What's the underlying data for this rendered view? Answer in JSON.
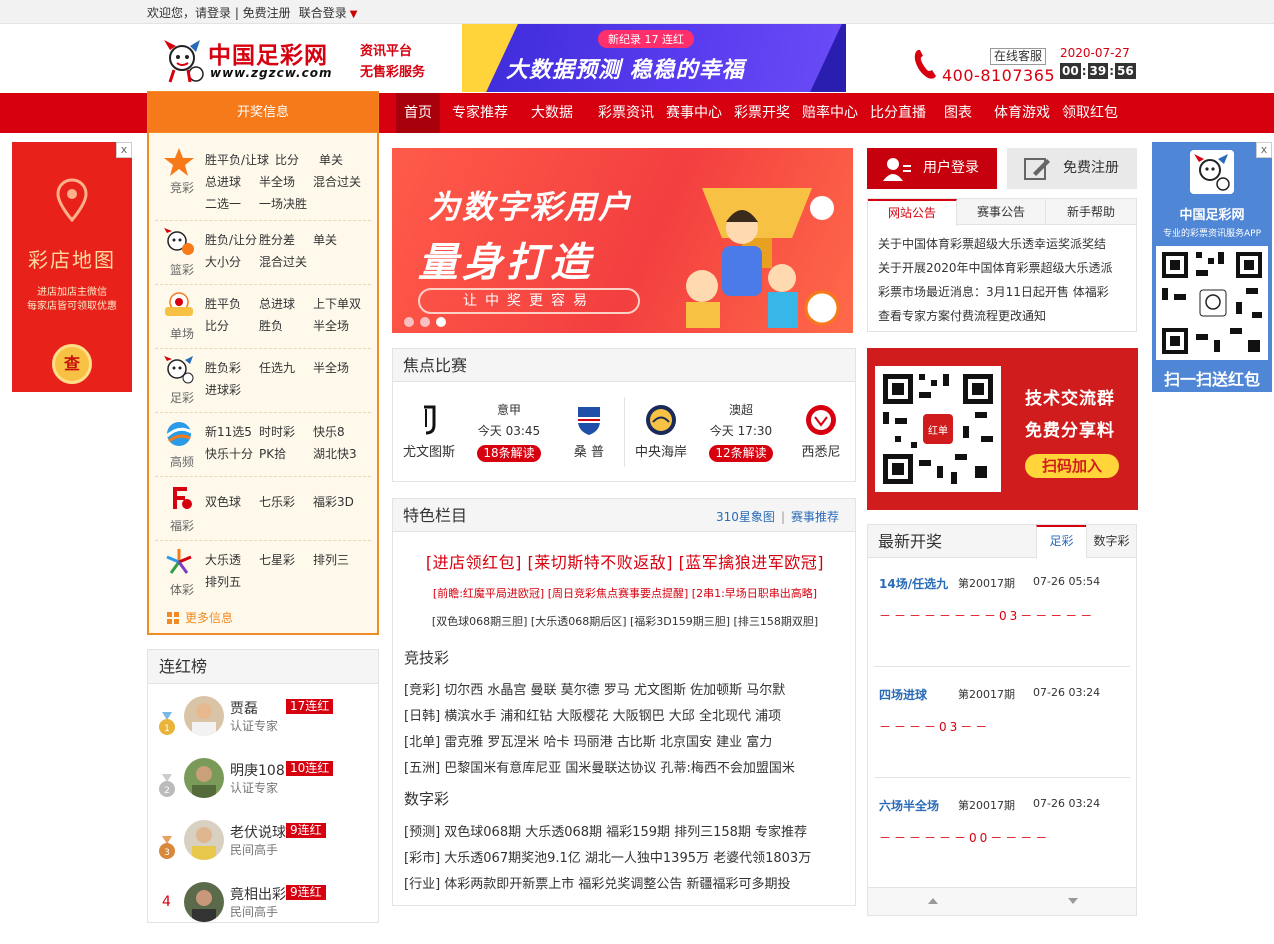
{
  "topbar": {
    "welcome": "欢迎您，请登录 | 免费注册",
    "union_login": "联合登录"
  },
  "header": {
    "logo_name": "中国足彩网",
    "logo_url": "www.zgzcw.com",
    "slogan1": "资讯平台",
    "slogan2": "无售彩服务",
    "banner_pill": "新纪录 17 连红",
    "banner_text": "大数据预测 稳稳的幸福",
    "online_service": "在线客服",
    "hotline": "400-8107365",
    "date": "2020-07-27",
    "clock": {
      "h": "00",
      "m": "39",
      "s": "56"
    }
  },
  "nav": {
    "kaijiang": "开奖信息",
    "items": [
      "首页",
      "专家推荐",
      "大数据",
      "彩票资讯",
      "赛事中心",
      "彩票开奖",
      "赔率中心",
      "比分直播",
      "图表",
      "体育游戏",
      "领取红包"
    ]
  },
  "side_ad": {
    "close": "x",
    "title": "彩店地图",
    "line1": "进店加店主微信",
    "line2": "每家店皆可领取优惠",
    "button": "查"
  },
  "lottery": {
    "rows": [
      {
        "cap": "竞彩",
        "links": [
          "胜平负/让球",
          "比分",
          "单关",
          "总进球",
          "半全场",
          "混合过关",
          "二选一",
          "一场决胜"
        ]
      },
      {
        "cap": "篮彩",
        "links": [
          "胜负/让分",
          "胜分差",
          "单关",
          "大小分",
          "混合过关"
        ]
      },
      {
        "cap": "单场",
        "links": [
          "胜平负",
          "总进球",
          "上下单双",
          "比分",
          "胜负",
          "半全场"
        ]
      },
      {
        "cap": "足彩",
        "links": [
          "胜负彩",
          "任选九",
          "半全场",
          "进球彩"
        ]
      },
      {
        "cap": "高频",
        "links": [
          "新11选5",
          "时时彩",
          "快乐8",
          "快乐十分",
          "PK拾",
          "湖北快3"
        ]
      },
      {
        "cap": "福彩",
        "links": [
          "双色球",
          "七乐彩",
          "福彩3D"
        ]
      },
      {
        "cap": "体彩",
        "links": [
          "大乐透",
          "七星彩",
          "排列三",
          "排列五"
        ]
      }
    ],
    "more": "更多信息"
  },
  "lhb": {
    "title": "连红榜",
    "users": [
      {
        "name": "贾磊",
        "level": "认证专家",
        "streak": "17连红",
        "rank": "1"
      },
      {
        "name": "明庚108",
        "level": "认证专家",
        "streak": "10连红",
        "rank": "2"
      },
      {
        "name": "老伏说球",
        "level": "民间高手",
        "streak": "9连红",
        "rank": "3"
      },
      {
        "name": "竟相出彩",
        "level": "民间高手",
        "streak": "9连红",
        "rank": "4"
      }
    ]
  },
  "banner": {
    "h1": "为数字彩用户",
    "h2": "量身打造",
    "sub": "让中奖更容易"
  },
  "focus": {
    "title": "焦点比赛",
    "matches": [
      {
        "league": "意甲",
        "time": "今天 03:45",
        "home": "尤文图斯",
        "away": "桑 普",
        "jiedu": "18条解读"
      },
      {
        "league": "澳超",
        "time": "今天 17:30",
        "home": "中央海岸",
        "away": "西悉尼",
        "jiedu": "12条解读"
      }
    ]
  },
  "featured": {
    "title": "特色栏目",
    "link1": "310星象图",
    "link2": "赛事推荐",
    "headline": "[进店领红包] [莱切斯特不败返敌] [蓝军擒狼进军欧冠]",
    "sub1": "[前瞻:红魔平局进欧冠] [周日竞彩焦点赛事要点提醒] [2串1:早场日职串出高略]",
    "sub2": "[双色球068期三胆] [大乐透068期后区] [福彩3D159期三胆] [排三158期双胆]",
    "sec1": "竞技彩",
    "lines1": [
      "[竞彩] 切尔西 水晶宫 曼联 莫尔德 罗马 尤文图斯 佐加顿斯 马尔默",
      "[日韩] 横滨水手 浦和红钻 大阪樱花 大阪钢巴 大邱 全北现代 浦项",
      "[北单] 雷克雅 罗瓦涅米 哈卡 玛丽港 古比斯 北京国安 建业 富力",
      "[五洲] 巴黎国米有意库尼亚 国米曼联达协议 孔蒂:梅西不会加盟国米"
    ],
    "sec2": "数字彩",
    "lines2": [
      "[预测] 双色球068期 大乐透068期 福彩159期 排列三158期 专家推荐",
      "[彩市] 大乐透067期奖池9.1亿 湖北一人独中1395万 老婆代领1803万",
      "[行业] 体彩两款即开新票上市 福彩兑奖调整公告 新疆福彩可多期投"
    ]
  },
  "login": {
    "login": "用户登录",
    "register": "免费注册"
  },
  "notice": {
    "tabs": [
      "网站公告",
      "赛事公告",
      "新手帮助"
    ],
    "items": [
      "关于中国体育彩票超级大乐透幸运奖派奖结",
      "关于开展2020年中国体育彩票超级大乐透派",
      "彩票市场最近消息：3月11日起开售 体福彩",
      "查看专家方案付费流程更改通知"
    ]
  },
  "qrad": {
    "t1": "技术交流群",
    "t2": "免费分享料",
    "btn": "扫码加入",
    "qr_label": "红单"
  },
  "newdraw": {
    "title": "最新开奖",
    "tabs": [
      "足彩",
      "数字彩"
    ],
    "entries": [
      {
        "name": "14场/任选九",
        "period": "第20017期",
        "time": "07-26 05:54",
        "result": "－－－－－－－－03－－－－－"
      },
      {
        "name": "四场进球",
        "period": "第20017期",
        "time": "07-26 03:24",
        "result": "－－－－03－－"
      },
      {
        "name": "六场半全场",
        "period": "第20017期",
        "time": "07-26 03:24",
        "result": "－－－－－－00－－－－"
      }
    ]
  },
  "rightad": {
    "close": "x",
    "t1": "中国足彩网",
    "t2": "专业的彩票资讯服务APP",
    "t3": "扫一扫送红包"
  },
  "colors": {
    "brand_red": "#d6000f",
    "orange": "#f77a1a",
    "link_blue": "#2a6bb8"
  }
}
